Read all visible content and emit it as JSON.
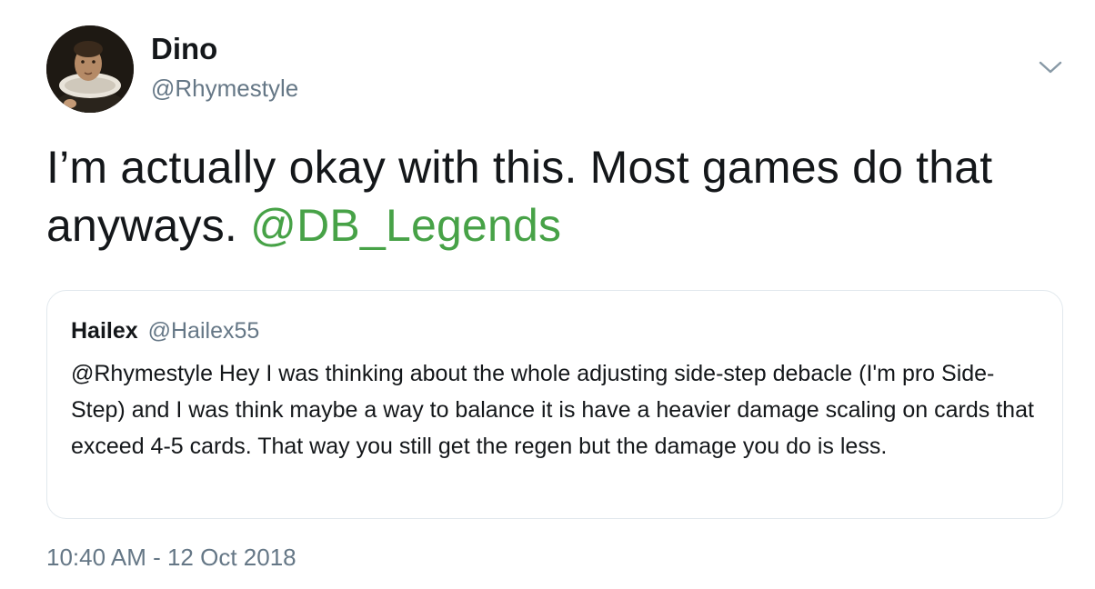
{
  "author": {
    "display_name": "Dino",
    "handle": "@Rhymestyle"
  },
  "tweet": {
    "text_before_mention": "I’m actually okay with this. Most games do that anyways. ",
    "mention": "@DB_Legends",
    "timestamp": "10:40 AM - 12 Oct 2018"
  },
  "quoted_tweet": {
    "display_name": "Hailex",
    "handle": "@Hailex55",
    "text": "@Rhymestyle Hey I was thinking about the whole adjusting side-step debacle (I'm pro Side-Step) and I was think maybe a way to balance it is have a heavier damage scaling on cards that exceed 4-5 cards. That way you still get the regen but the damage you do is less."
  },
  "icons": {
    "menu": "chevron-down-icon",
    "avatar": "profile-photo"
  },
  "colors": {
    "mention": "#47a247",
    "secondary_text": "#657786",
    "card_border": "#e1e8ed"
  }
}
